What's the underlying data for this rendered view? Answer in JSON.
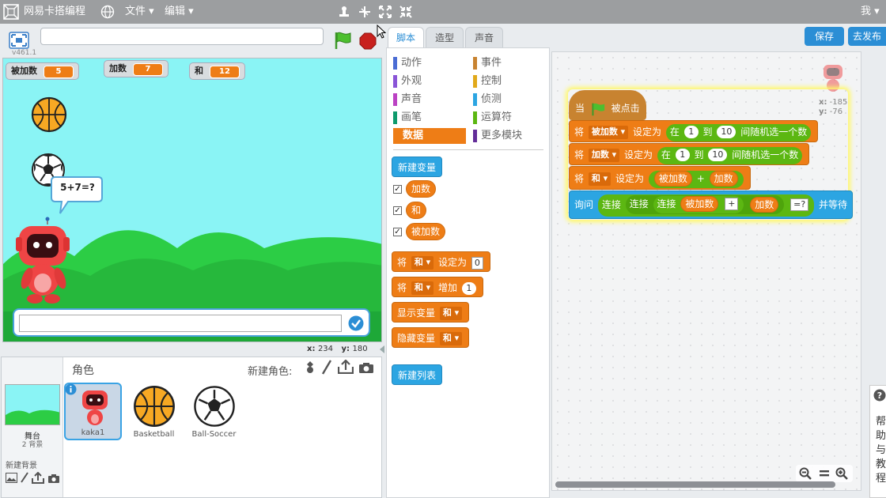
{
  "topbar": {
    "brand": "网易卡搭编程",
    "file_menu": "文件",
    "edit_menu": "编辑",
    "user_menu": "我"
  },
  "stage": {
    "version": "v461.1",
    "monitors": [
      {
        "label": "被加数",
        "value": "5"
      },
      {
        "label": "加数",
        "value": "7"
      },
      {
        "label": "和",
        "value": "12"
      }
    ],
    "speech": "5+7=?",
    "answer_value": "",
    "coords": {
      "x_label": "x:",
      "x": "234",
      "y_label": "y:",
      "y": "180"
    }
  },
  "tabs": [
    "脚本",
    "造型",
    "声音"
  ],
  "actions": {
    "save": "保存",
    "publish": "去发布"
  },
  "categories": [
    {
      "label": "动作",
      "color": "#4a6cd4"
    },
    {
      "label": "事件",
      "color": "#c88330"
    },
    {
      "label": "外观",
      "color": "#8a55d7"
    },
    {
      "label": "控制",
      "color": "#e1a91a"
    },
    {
      "label": "声音",
      "color": "#bb42c3"
    },
    {
      "label": "侦测",
      "color": "#2ca5e2"
    },
    {
      "label": "画笔",
      "color": "#0e9a6c"
    },
    {
      "label": "运算符",
      "color": "#5cb712"
    },
    {
      "label": "数据",
      "color": "#ee7d16"
    },
    {
      "label": "更多模块",
      "color": "#632d99"
    }
  ],
  "palette": {
    "new_variable": "新建变量",
    "variables": [
      "加数",
      "和",
      "被加数"
    ],
    "set_block": {
      "prefix": "将",
      "var": "和",
      "mid": "设定为",
      "value": "0"
    },
    "change_block": {
      "prefix": "将",
      "var": "和",
      "mid": "增加",
      "value": "1"
    },
    "show_block": {
      "text": "显示变量",
      "var": "和"
    },
    "hide_block": {
      "text": "隐藏变量",
      "var": "和"
    },
    "new_list": "新建列表"
  },
  "script": {
    "hat": {
      "when": "当",
      "clicked": "被点击"
    },
    "set1": {
      "prefix": "将",
      "var": "被加数",
      "mid": "设定为",
      "in": "在",
      "from": "1",
      "to_word": "到",
      "to": "10",
      "suffix": "间随机选一个数"
    },
    "set2": {
      "prefix": "将",
      "var": "加数",
      "mid": "设定为",
      "in": "在",
      "from": "1",
      "to_word": "到",
      "to": "10",
      "suffix": "间随机选一个数"
    },
    "set3": {
      "prefix": "将",
      "var": "和",
      "mid": "设定为",
      "a": "被加数",
      "op": "+",
      "b": "加数"
    },
    "ask": {
      "ask": "询问",
      "join": "连接",
      "a": "被加数",
      "plus": "+",
      "b": "加数",
      "eq": "=?",
      "wait": "并等待"
    },
    "sprite_coords": {
      "x_label": "x:",
      "x": "-185",
      "y_label": "y:",
      "y": "-76"
    }
  },
  "sprites_panel": {
    "title": "角色",
    "new_sprite": "新建角色:",
    "stage_label": "舞台",
    "stage_backdrops": "2 背景",
    "new_backdrop": "新建背景",
    "sprites": [
      "kaka1",
      "Basketball",
      "Ball-Soccer"
    ]
  },
  "help": {
    "text": "帮助与教程"
  }
}
